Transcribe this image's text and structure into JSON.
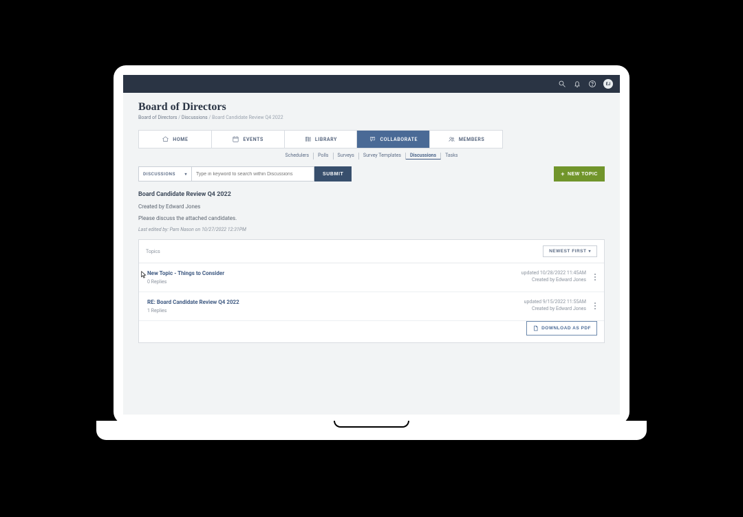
{
  "topbar": {
    "avatar_initials": "EJ"
  },
  "page": {
    "title": "Board of Directors",
    "breadcrumb": [
      "Board of Directors",
      "Discussions",
      "Board Candidate Review Q4 2022"
    ]
  },
  "tabs": {
    "home": "HOME",
    "events": "EVENTS",
    "library": "LIBRARY",
    "collaborate": "COLLABORATE",
    "members": "MEMBERS"
  },
  "subtabs": [
    "Schedulers",
    "Polls",
    "Surveys",
    "Survey Templates",
    "Discussions",
    "Tasks"
  ],
  "subtabs_active_index": 4,
  "search": {
    "scope_label": "DISCUSSIONS",
    "placeholder": "Type in keyword to search within Discussions",
    "submit": "SUBMIT",
    "new_topic": "NEW TOPIC"
  },
  "thread": {
    "title": "Board Candidate Review Q4 2022",
    "creator_line": "Created by Edward Jones",
    "description": "Please discuss the attached candidates.",
    "last_edited": "Last edited by: Pam Nason on 10/27/2022 12:31PM"
  },
  "topics_box": {
    "header": "Topics",
    "sort_label": "NEWEST FIRST",
    "topics": [
      {
        "title": "New Topic - Things to Consider",
        "replies": "0 Replies",
        "updated": "updated 10/28/2022 11:45AM",
        "created_by": "Created by Edward Jones"
      },
      {
        "title": "RE: Board Candidate Review Q4 2022",
        "replies": "1 Replies",
        "updated": "updated 9/15/2022 11:55AM",
        "created_by": "Created by Edward Jones"
      }
    ],
    "download": "DOWNLOAD AS PDF"
  }
}
